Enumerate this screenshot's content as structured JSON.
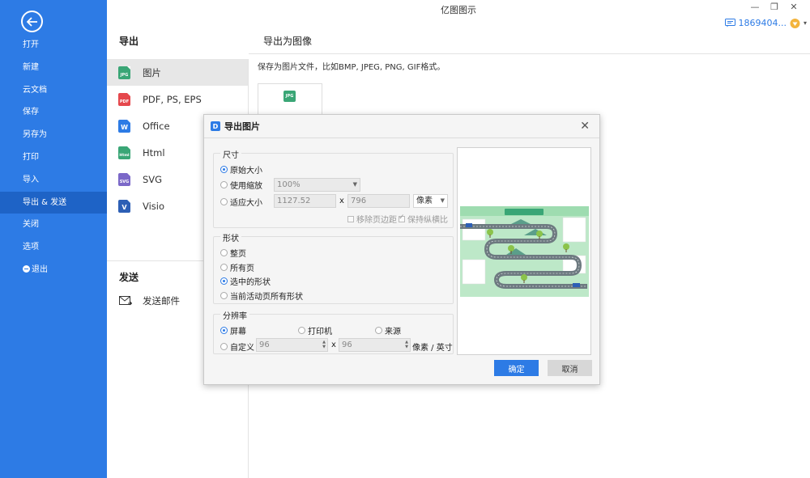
{
  "app": {
    "title": "亿图图示"
  },
  "window_controls": {
    "minimize": "—",
    "restore": "❐",
    "close": "✕"
  },
  "user": {
    "name": "1869404...",
    "caret": "▾"
  },
  "sidebar": {
    "items": [
      {
        "label": "打开"
      },
      {
        "label": "新建"
      },
      {
        "label": "云文档"
      },
      {
        "label": "保存"
      },
      {
        "label": "另存为"
      },
      {
        "label": "打印"
      },
      {
        "label": "导入"
      },
      {
        "label": "导出 & 发送",
        "active": true
      },
      {
        "label": "关闭"
      },
      {
        "label": "选项"
      },
      {
        "label": "退出"
      }
    ]
  },
  "export": {
    "title": "导出",
    "formats": [
      {
        "label": "图片",
        "tag": "JPG",
        "color": "#3aa676",
        "active": true
      },
      {
        "label": "PDF, PS, EPS",
        "tag": "PDF",
        "color": "#e5484d"
      },
      {
        "label": "Office",
        "tag": "W",
        "color": "#2d7be5"
      },
      {
        "label": "Html",
        "tag": "Html",
        "color": "#3aa676"
      },
      {
        "label": "SVG",
        "tag": "SVG",
        "color": "#7b68c8"
      },
      {
        "label": "Visio",
        "tag": "V",
        "color": "#2d5fb5"
      }
    ]
  },
  "send": {
    "title": "发送",
    "email": "发送邮件"
  },
  "right": {
    "title": "导出为图像",
    "description": "保存为图片文件，比如BMP, JPEG, PNG, GIF格式。",
    "card_tag": "JPG"
  },
  "dialog": {
    "title": "导出图片",
    "logo": "D",
    "close": "✕",
    "size": {
      "legend": "尺寸",
      "original": "原始大小",
      "use_zoom": "使用缩放",
      "zoom_value": "100%",
      "fit": "适应大小",
      "width": "1127.52",
      "times": "x",
      "height": "796",
      "unit": "像素",
      "remove_margin": "移除页边距",
      "keep_ratio": "保持纵横比"
    },
    "shape": {
      "legend": "形状",
      "options": [
        "整页",
        "所有页",
        "选中的形状",
        "当前活动页所有形状"
      ],
      "selected_index": 2
    },
    "resolution": {
      "legend": "分辨率",
      "screen": "屏幕",
      "printer": "打印机",
      "source": "来源",
      "custom": "自定义",
      "x_value": "96",
      "times": "x",
      "y_value": "96",
      "unit": "像素 / 英寸"
    },
    "ok": "确定",
    "cancel": "取消"
  },
  "colors": {
    "accent": "#2d7be5",
    "sidebar": "#2d7be5",
    "preview_bg": "#bde8c8",
    "road": "#6d7a80"
  }
}
